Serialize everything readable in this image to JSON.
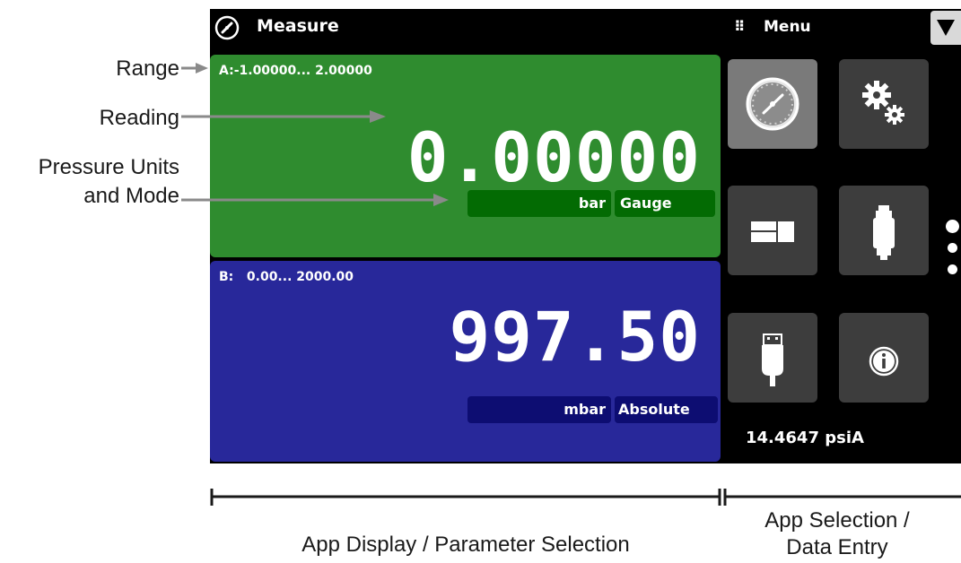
{
  "header": {
    "title": "Measure",
    "menu_icon": "⠿",
    "menu_label": "Menu"
  },
  "channel_a": {
    "range": "A:-1.00000... 2.00000",
    "reading": "0.00000",
    "unit": "bar",
    "mode": "Gauge",
    "color": "#2f8c2f"
  },
  "channel_b": {
    "range": "B:   0.00... 2000.00",
    "reading": "997.50",
    "unit": "mbar",
    "mode": "Absolute",
    "color": "#28289a"
  },
  "apps": [
    {
      "icon": "pressure-gauge-icon",
      "active": true
    },
    {
      "icon": "settings-gears-icon",
      "active": false
    },
    {
      "icon": "display-layout-icon",
      "active": false
    },
    {
      "icon": "pressure-sensor-icon",
      "active": false
    },
    {
      "icon": "usb-connector-icon",
      "active": false
    },
    {
      "icon": "info-icon",
      "active": false
    }
  ],
  "barometer": "14.4647 psiA",
  "pagination": {
    "pages": 3,
    "current": 1
  },
  "callouts": {
    "range": "Range",
    "reading": "Reading",
    "units_line1": "Pressure Units",
    "units_line2": "and Mode"
  },
  "sections": {
    "app_display": "App Display / Parameter Selection",
    "app_selection_line1": "App Selection /",
    "app_selection_line2": "Data Entry"
  }
}
